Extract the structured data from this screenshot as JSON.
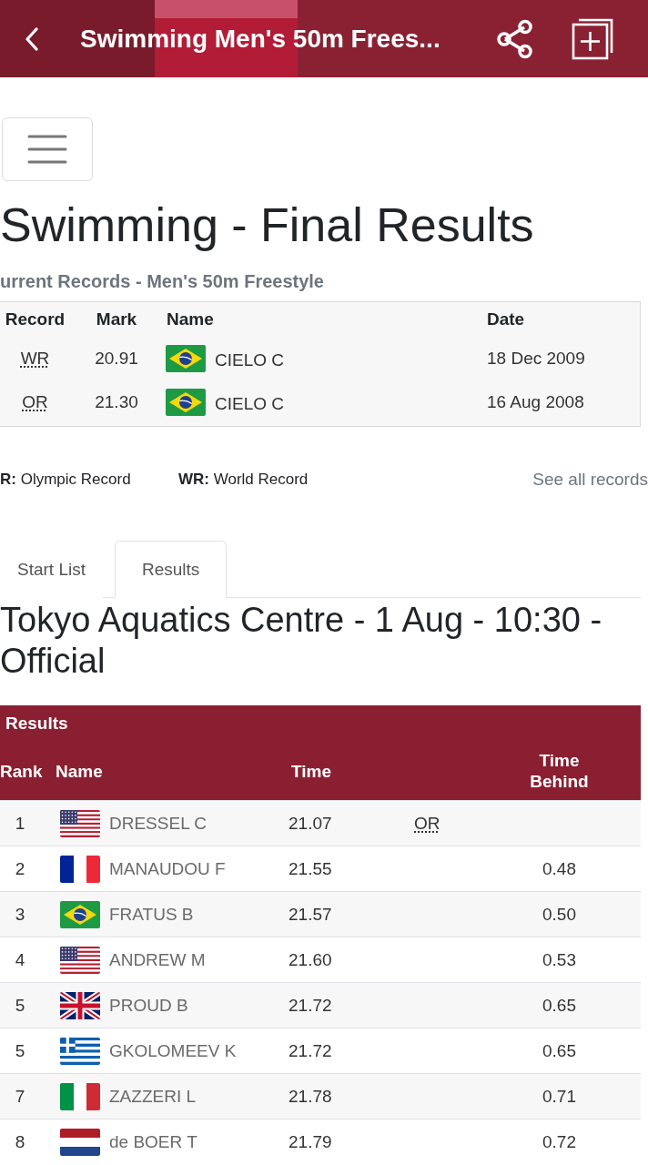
{
  "header": {
    "title": "Swimming Men's 50m Frees..."
  },
  "page_title": "Swimming - Final Results",
  "records": {
    "title": "urrent Records - Men's 50m Freestyle",
    "columns": {
      "record": "Record",
      "mark": "Mark",
      "name": "Name",
      "date": "Date"
    },
    "rows": [
      {
        "record": "WR",
        "mark": "20.91",
        "flag": {
          "kind": "brazil"
        },
        "name": "CIELO C",
        "date": "18 Dec 2009"
      },
      {
        "record": "OR",
        "mark": "21.30",
        "flag": {
          "kind": "brazil"
        },
        "name": "CIELO C",
        "date": "16 Aug 2008"
      }
    ]
  },
  "legend": [
    "**R:** Olympic Record",
    "**WR:** World Record"
  ],
  "see_all_link": "See all records",
  "tabs": [
    {
      "label": "Start List",
      "selected": false
    },
    {
      "label": "Results",
      "selected": true
    }
  ],
  "venue_heading": "Tokyo Aquatics Centre - 1 Aug - 10:30 - Official",
  "results": {
    "title": "Results",
    "columns": {
      "rank": "Rank",
      "name": "Name",
      "time": "Time",
      "time_behind": "Time Behind"
    },
    "rows": [
      {
        "rank": "1",
        "flag": {
          "kind": "usa"
        },
        "name": "DRESSEL C",
        "time": "21.07",
        "record": "OR"
      },
      {
        "rank": "2",
        "flag": {
          "kind": "france"
        },
        "name": "MANAUDOU F",
        "time": "21.55",
        "time_behind": "0.48"
      },
      {
        "rank": "3",
        "flag": {
          "kind": "brazil"
        },
        "name": "FRATUS B",
        "time": "21.57",
        "time_behind": "0.50"
      },
      {
        "rank": "4",
        "flag": {
          "kind": "usa"
        },
        "name": "ANDREW M",
        "time": "21.60",
        "time_behind": "0.53"
      },
      {
        "rank": "5",
        "flag": {
          "kind": "uk"
        },
        "name": "PROUD B",
        "time": "21.72",
        "time_behind": "0.65"
      },
      {
        "rank": "5",
        "flag": {
          "kind": "greece"
        },
        "name": "GKOLOMEEV K",
        "time": "21.72",
        "time_behind": "0.65"
      },
      {
        "rank": "7",
        "flag": {
          "kind": "italy"
        },
        "name": "ZAZZERI L",
        "time": "21.78",
        "time_behind": "0.71"
      },
      {
        "rank": "8",
        "flag": {
          "kind": "netherlands"
        },
        "name": "de BOER T",
        "time": "21.79",
        "time_behind": "0.72"
      }
    ]
  }
}
